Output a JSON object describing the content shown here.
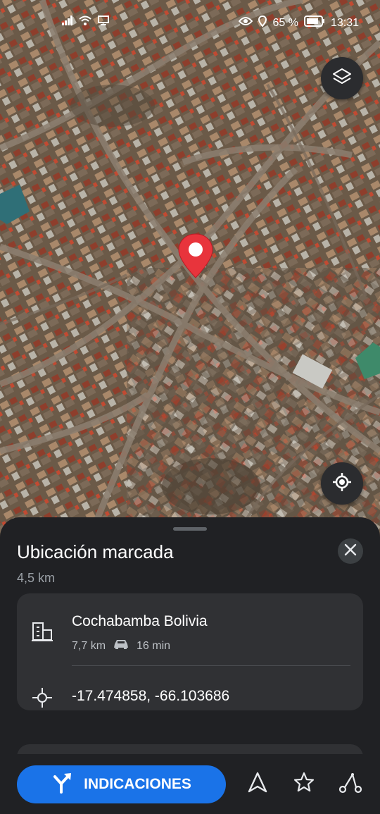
{
  "status_bar": {
    "battery": "65 %",
    "time": "13:31"
  },
  "map": {
    "layers_icon": "layers-icon",
    "locate_icon": "my-location-icon",
    "pin_color": "#e8343c"
  },
  "sheet": {
    "title": "Ubicación marcada",
    "distance": "4,5 km",
    "place_name": "Cochabamba Bolivia",
    "place_distance": "7,7 km",
    "place_time": "16 min",
    "coordinates": "-17.474858, -66.103686"
  },
  "actions": {
    "directions_label": "INDICACIONES",
    "navigate_icon": "navigate-arrow-icon",
    "save_icon": "star-icon",
    "route_icon": "route-icon"
  },
  "colors": {
    "accent": "#1a73e8",
    "sheet_bg": "#202124",
    "card_bg": "#303134"
  }
}
